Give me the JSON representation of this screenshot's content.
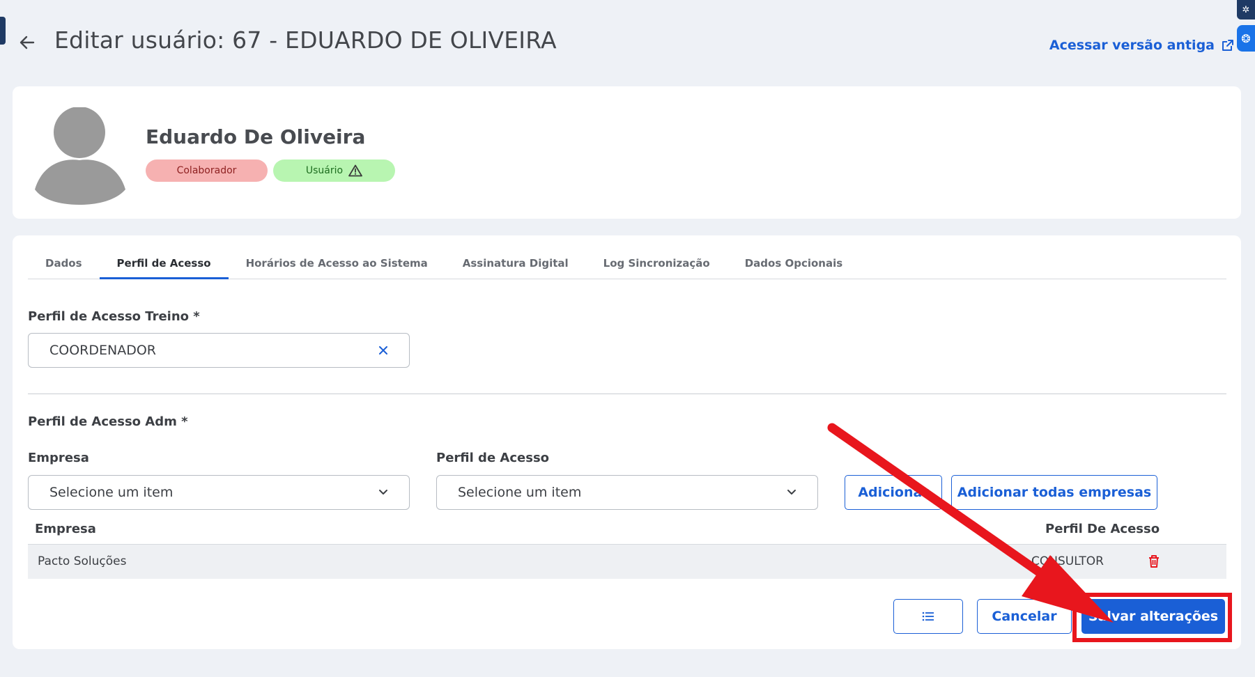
{
  "header": {
    "title": "Editar usuário: 67 - EDUARDO DE OLIVEIRA",
    "old_version_link": "Acessar versão antiga"
  },
  "profile": {
    "name": "Eduardo De Oliveira",
    "badges": [
      {
        "label": "Colaborador",
        "color": "#f6b1b1"
      },
      {
        "label": "Usuário",
        "color": "#b8f5b1",
        "icon": "warning-icon"
      }
    ]
  },
  "tabs": [
    {
      "label": "Dados",
      "active": false
    },
    {
      "label": "Perfil de Acesso",
      "active": true
    },
    {
      "label": "Horários de Acesso ao Sistema",
      "active": false
    },
    {
      "label": "Assinatura Digital",
      "active": false
    },
    {
      "label": "Log Sincronização",
      "active": false
    },
    {
      "label": "Dados Opcionais",
      "active": false
    }
  ],
  "treino": {
    "label": "Perfil de Acesso Treino *",
    "value": "COORDENADOR"
  },
  "adm": {
    "label": "Perfil de Acesso Adm *",
    "empresa_label": "Empresa",
    "empresa_value": "Selecione um item",
    "perfil_label": "Perfil de Acesso",
    "perfil_value": "Selecione um item",
    "add_button": "Adicionar",
    "add_all_button": "Adicionar todas empresas"
  },
  "table": {
    "columns": [
      "Empresa",
      "Perfil De Acesso"
    ],
    "rows": [
      {
        "empresa": "Pacto Soluções",
        "perfil": "CONSULTOR"
      }
    ]
  },
  "footer": {
    "cancel_button": "Cancelar",
    "save_button": "Salvar alterações"
  },
  "colors": {
    "accent": "#1a5fd6",
    "annotation": "#e8161d",
    "background": "#eef1f6"
  }
}
